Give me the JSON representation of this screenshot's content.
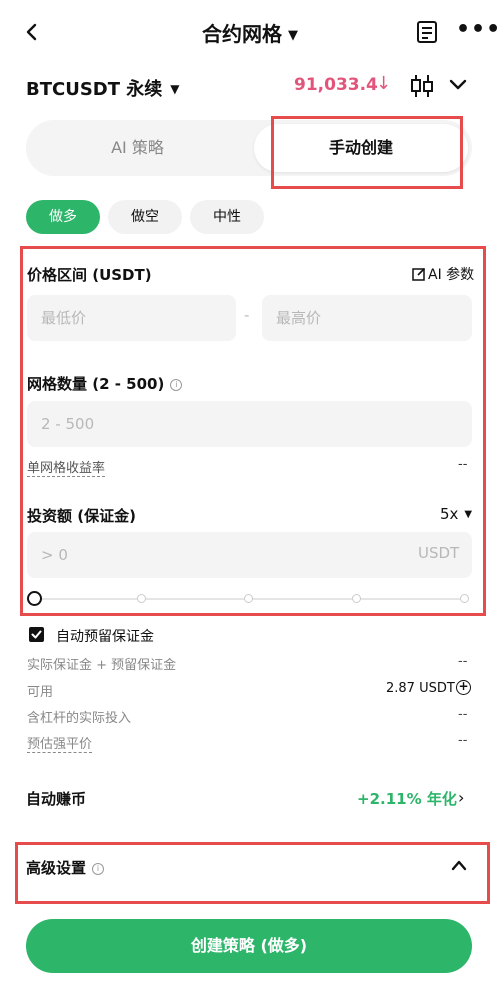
{
  "header": {
    "title": "合约网格"
  },
  "symbol": {
    "name": "BTCUSDT 永续",
    "price": "91,033.4"
  },
  "mode_tabs": {
    "ai": "AI 策略",
    "manual": "手动创建"
  },
  "direction": {
    "long": "做多",
    "short": "做空",
    "neutral": "中性"
  },
  "price_range": {
    "label": "价格区间 (USDT)",
    "ai_params": "AI 参数",
    "min_placeholder": "最低价",
    "separator": "-",
    "max_placeholder": "最高价"
  },
  "grid_count": {
    "label": "网格数量 (2 - 500)",
    "placeholder": "2 - 500",
    "per_grid_profit_label": "单网格收益率",
    "per_grid_profit_value": "--"
  },
  "investment": {
    "label": "投资额 (保证金)",
    "leverage": "5x",
    "placeholder": "> 0",
    "unit": "USDT",
    "slider_value": 0
  },
  "auto_reserve": {
    "label": "自动预留保证金",
    "checked": true
  },
  "info_rows": {
    "margin_label": "实际保证金 + 预留保证金",
    "margin_value": "--",
    "available_label": "可用",
    "available_value": "2.87 USDT",
    "leveraged_label": "含杠杆的实际投入",
    "leveraged_value": "--",
    "liq_label": "预估强平价",
    "liq_value": "--"
  },
  "auto_earn": {
    "label": "自动赚币",
    "value": "+2.11% 年化"
  },
  "advanced": {
    "label": "高级设置"
  },
  "cta": {
    "label": "创建策略 (做多)"
  },
  "colors": {
    "accent_green": "#2db56a",
    "price_red": "#e2557b",
    "highlight": "#e74c4c"
  }
}
